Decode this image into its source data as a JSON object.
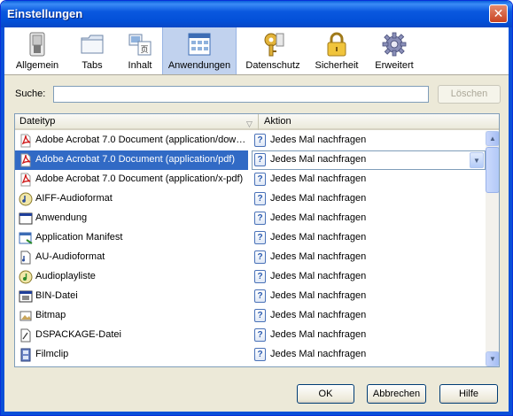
{
  "window": {
    "title": "Einstellungen",
    "close_glyph": "✕"
  },
  "toolbar": {
    "items": [
      {
        "label": "Allgemein",
        "icon": "switch-icon"
      },
      {
        "label": "Tabs",
        "icon": "folder-tabs-icon"
      },
      {
        "label": "Inhalt",
        "icon": "content-icon"
      },
      {
        "label": "Anwendungen",
        "icon": "applications-icon",
        "selected": true
      },
      {
        "label": "Datenschutz",
        "icon": "privacy-key-icon"
      },
      {
        "label": "Sicherheit",
        "icon": "padlock-icon"
      },
      {
        "label": "Erweitert",
        "icon": "gear-icon"
      }
    ]
  },
  "search": {
    "label": "Suche:",
    "value": "",
    "clear_label": "Löschen"
  },
  "list": {
    "columns": {
      "type": "Dateityp",
      "action": "Aktion"
    },
    "rows": [
      {
        "type": "Adobe Acrobat 7.0 Document (application/dow…",
        "icon": "pdf-icon",
        "action": "Jedes Mal nachfragen"
      },
      {
        "type": "Adobe Acrobat 7.0 Document (application/pdf)",
        "icon": "pdf-icon",
        "action": "Jedes Mal nachfragen",
        "selected": true
      },
      {
        "type": "Adobe Acrobat 7.0 Document (application/x-pdf)",
        "icon": "pdf-icon",
        "action": "Jedes Mal nachfragen"
      },
      {
        "type": "AIFF-Audioformat",
        "icon": "audio-file-icon",
        "action": "Jedes Mal nachfragen"
      },
      {
        "type": "Anwendung",
        "icon": "application-window-icon",
        "action": "Jedes Mal nachfragen"
      },
      {
        "type": "Application Manifest",
        "icon": "manifest-icon",
        "action": "Jedes Mal nachfragen"
      },
      {
        "type": "AU-Audioformat",
        "icon": "au-file-icon",
        "action": "Jedes Mal nachfragen"
      },
      {
        "type": "Audioplayliste",
        "icon": "playlist-icon",
        "action": "Jedes Mal nachfragen"
      },
      {
        "type": "BIN-Datei",
        "icon": "bin-file-icon",
        "action": "Jedes Mal nachfragen"
      },
      {
        "type": "Bitmap",
        "icon": "bitmap-icon",
        "action": "Jedes Mal nachfragen"
      },
      {
        "type": "DSPACKAGE-Datei",
        "icon": "dspackage-icon",
        "action": "Jedes Mal nachfragen"
      },
      {
        "type": "Filmclip",
        "icon": "film-icon",
        "action": "Jedes Mal nachfragen"
      }
    ]
  },
  "buttons": {
    "ok": "OK",
    "cancel": "Abbrechen",
    "help": "Hilfe"
  }
}
